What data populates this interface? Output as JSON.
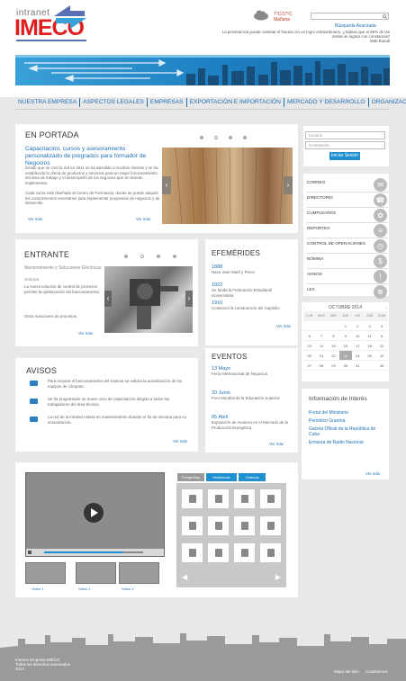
{
  "header": {
    "logo_small": "intranet",
    "logo_big": "IMECO",
    "temperature_line1": "7ºC/17ºC",
    "temperature_line2": "Mañana",
    "search_placeholder": "",
    "advanced_search": "Búsqueda Avanzada",
    "quote": "La persistencia puede cambiar el fracaso en un logro extraordinario. ¿Sabías que el 80% de las metas se logran con constancia?",
    "quote_author": "Matt Biondi"
  },
  "nav": {
    "items": [
      "NUESTRA EMPRESA",
      "ASPECTOS LEGALES",
      "EMPRESAS",
      "EXPORTACIÓN E IMPORTACIÓN",
      "MERCADO Y DESARROLLO",
      "ORGANIZACIONES"
    ]
  },
  "portada": {
    "title": "EN PORTADA",
    "headline": "Capacitación, cursos y asesoramiento personalizado de pregrados para formador de Negocios",
    "para1": "Desde que se creó la red en 2011 se ha atendido a muchos clientes y se ha establecido la oferta de productos y servicios para un mejor funcionamiento del área de trabajo y el desempeño de los negocios que se desean implementar.",
    "para2": "Cada curso está diseñado al Centro de Formación, donde se puede adquirir los conocimientos necesarios para implementar programas de negocios y de desarrollo.",
    "more_left": "Ver más",
    "more_right": "Ver más"
  },
  "entrante": {
    "title": "ENTRANTE",
    "item_title": "Mantenimiento y Soluciones Eléctricas",
    "item_sub": "Ordenar",
    "body1": "La nueva solución de control de procesos permite la optimización del funcionamiento.",
    "body2": "Otras soluciones de procesos.",
    "more": "Ver más"
  },
  "efemerides": {
    "title": "EFEMÉRIDES",
    "items": [
      {
        "year": "1888",
        "text": "Nace José Martí y Pérez"
      },
      {
        "year": "1922",
        "text": "Se funda la Federación Estudiantil Universitaria"
      },
      {
        "year": "1910",
        "text": "Comienza la construcción del Capitolio"
      }
    ],
    "more": "Ver más"
  },
  "eventos": {
    "title": "EVENTOS",
    "items": [
      {
        "date": "13 Mayo",
        "text": "Feria Internacional de Negocios"
      },
      {
        "date": "20 Junio",
        "text": "Foro Mundial de la Educación Superior"
      },
      {
        "date": "05 Abril",
        "text": "Exposición de Avances en el Mercado de la Producción Energética"
      }
    ],
    "more": "Ver más"
  },
  "avisos": {
    "title": "AVISOS",
    "items": [
      "Para mejorar el funcionamiento del sistema se solicita la actualización de los equipos de cómputo.",
      "Se ha programado un nuevo ciclo de capacitación dirigido a todos los trabajadores del área técnica.",
      "La red de la intranet estará en mantenimiento durante el fin de semana para su actualización."
    ],
    "more": "Ver más"
  },
  "login": {
    "user_placeholder": "Usuario",
    "pass_placeholder": "Contraseña",
    "button": "Iniciar Sesión"
  },
  "services": {
    "items": [
      "CORREO",
      "DIRECTORIO",
      "CUMPLEAÑOS",
      "REPORTES",
      "CONTROL DE OPERACIONES",
      "NÓMINA",
      "AVISOS",
      "LEX"
    ]
  },
  "calendar": {
    "title": "OCTUBRE 2014",
    "days": [
      "LUN",
      "MAR",
      "MIÉ",
      "JUE",
      "VIE",
      "SÁB",
      "DOM"
    ],
    "weeks": [
      [
        "",
        "",
        "",
        "1",
        "2",
        "3",
        "4"
      ],
      [
        "6",
        "7",
        "8",
        "9",
        "10",
        "11",
        "5"
      ],
      [
        "13",
        "14",
        "15",
        "16",
        "17",
        "18",
        "12"
      ],
      [
        "20",
        "21",
        "22",
        "23",
        "24",
        "25",
        "19"
      ],
      [
        "27",
        "28",
        "29",
        "30",
        "31",
        "",
        "26"
      ]
    ],
    "today": "23"
  },
  "informacion": {
    "title": "Información de Interés",
    "links": [
      "Portal del Ministerio",
      "Periódico Granma",
      "Gaceta Oficial de la República de Cuba",
      "Emisora de Radio Nacional"
    ],
    "more": "Ver más"
  },
  "media": {
    "tabs": [
      "Fotografías",
      "Multimedia",
      "Galerías"
    ],
    "thumb_labels": [
      "Video 1",
      "Video 2",
      "Video 3"
    ]
  },
  "footer": {
    "line1": "Intranet Empresa IMECO",
    "line2": "Todos los derechos reservados",
    "line3": "2014",
    "link1": "Mapa del Sitio",
    "link2": "Contáctenos"
  }
}
